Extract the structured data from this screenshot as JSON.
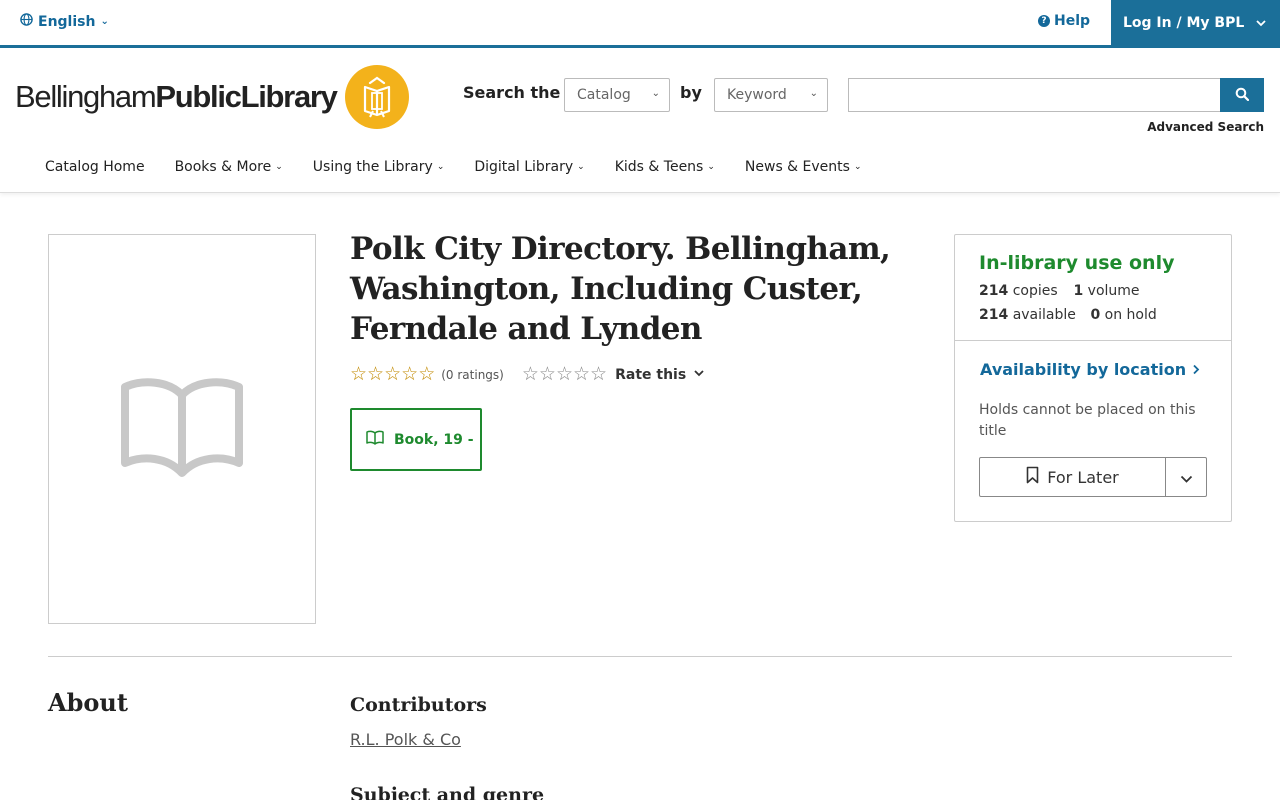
{
  "utility": {
    "language_label": "English",
    "help_label": "Help",
    "login_label": "Log In / My BPL"
  },
  "header": {
    "logo_text_light": "Bellingham",
    "logo_text_bold": "PublicLibrary",
    "search_label": "Search the",
    "search_scope": "Catalog",
    "by_label": "by",
    "search_field": "Keyword",
    "search_value": "",
    "advanced_search": "Advanced Search"
  },
  "nav": {
    "items": [
      {
        "label": "Catalog Home",
        "has_menu": false
      },
      {
        "label": "Books & More",
        "has_menu": true
      },
      {
        "label": "Using the Library",
        "has_menu": true
      },
      {
        "label": "Digital Library",
        "has_menu": true
      },
      {
        "label": "Kids & Teens",
        "has_menu": true
      },
      {
        "label": "News & Events",
        "has_menu": true
      }
    ]
  },
  "record": {
    "title": "Polk City Directory. Bellingham, Washington, Including Custer, Ferndale and Lynden",
    "rating_count": "(0 ratings)",
    "average_rating": 0,
    "rate_this": "Rate this",
    "format_label": "Book, 19 -"
  },
  "availability": {
    "status": "In-library use only",
    "copies_count": "214",
    "copies_label": "copies",
    "volume_count": "1",
    "volume_label": "volume",
    "available_count": "214",
    "available_label": "available",
    "hold_count": "0",
    "hold_label": "on hold",
    "location_link": "Availability by location",
    "holds_note": "Holds cannot be placed on this title",
    "for_later": "For Later"
  },
  "about": {
    "heading": "About",
    "contributors_heading": "Contributors",
    "contributor": "R.L. Polk & Co",
    "subject_heading": "Subject and genre"
  },
  "colors": {
    "brand_blue": "#1b6f99",
    "link_blue": "#13689a",
    "status_green": "#1e8a2e",
    "logo_gold": "#f3b21b"
  }
}
